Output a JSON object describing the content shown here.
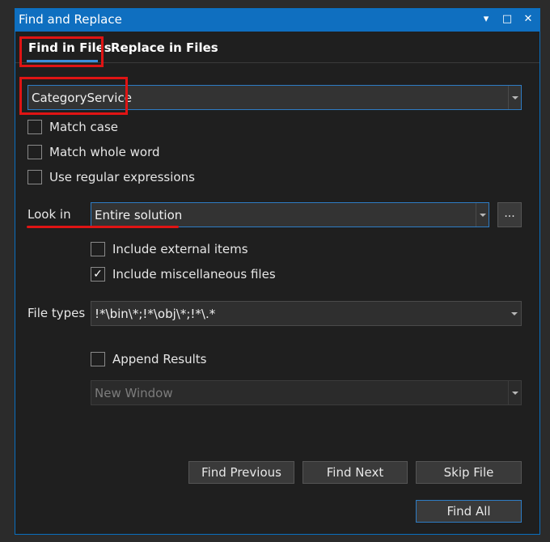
{
  "window": {
    "title": "Find and Replace",
    "controls": {
      "pin": "▾",
      "maximize": "□",
      "close": "✕"
    }
  },
  "tabs": [
    {
      "label": "Find in Files",
      "active": true
    },
    {
      "label": "Replace in Files",
      "active": false
    }
  ],
  "search": {
    "value": "CategoryService"
  },
  "options": {
    "match_case": {
      "label": "Match case",
      "checked": false
    },
    "match_whole_word": {
      "label": "Match whole word",
      "checked": false
    },
    "regex": {
      "label": "Use regular expressions",
      "checked": false
    }
  },
  "look_in": {
    "label": "Look in",
    "value": "Entire solution",
    "browse_label": "..."
  },
  "include": {
    "external": {
      "label": "Include external items",
      "checked": false
    },
    "misc": {
      "label": "Include miscellaneous files",
      "checked": true,
      "mark": "✓"
    }
  },
  "file_types": {
    "label": "File types",
    "value": "!*\\bin\\*;!*\\obj\\*;!*\\.*"
  },
  "results": {
    "append": {
      "label": "Append Results",
      "checked": false
    },
    "window": {
      "value": "New Window"
    }
  },
  "buttons": {
    "find_previous": "Find Previous",
    "find_next": "Find Next",
    "skip_file": "Skip File",
    "find_all": "Find All"
  },
  "colors": {
    "accent": "#0f6fc0",
    "highlight": "#e01414"
  }
}
